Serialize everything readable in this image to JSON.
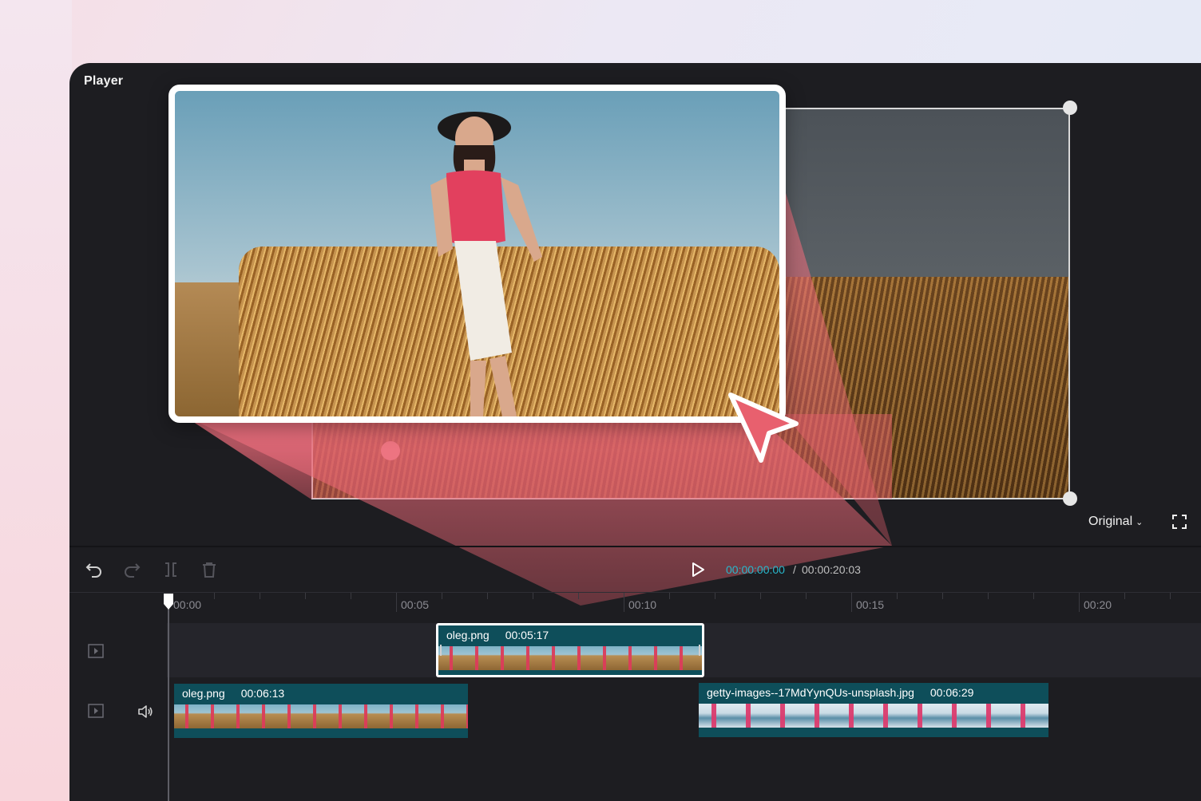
{
  "player": {
    "title": "Player"
  },
  "preview": {
    "ratio_label": "Original",
    "accent_color": "#e8606e"
  },
  "transport": {
    "current_time": "00:00:00:00",
    "separator": "/",
    "total_time": "00:00:20:03",
    "current_color": "#28b8cc"
  },
  "ruler": {
    "labels": [
      "00:00",
      "00:05",
      "00:10",
      "00:15",
      "00:20"
    ]
  },
  "tracks": {
    "overlay_clip": {
      "name": "oleg.png",
      "duration": "00:05:17"
    },
    "main_clip_1": {
      "name": "oleg.png",
      "duration": "00:06:13"
    },
    "main_clip_2": {
      "name": "getty-images--17MdYynQUs-unsplash.jpg",
      "duration": "00:06:29"
    }
  },
  "icons": {
    "undo": "undo-icon",
    "redo": "redo-icon",
    "split": "split-icon",
    "delete": "trash-icon",
    "play": "play-icon",
    "fullscreen": "fullscreen-icon",
    "track_video": "video-track-icon",
    "audio": "speaker-icon",
    "cursor": "pointer-cursor-icon"
  }
}
